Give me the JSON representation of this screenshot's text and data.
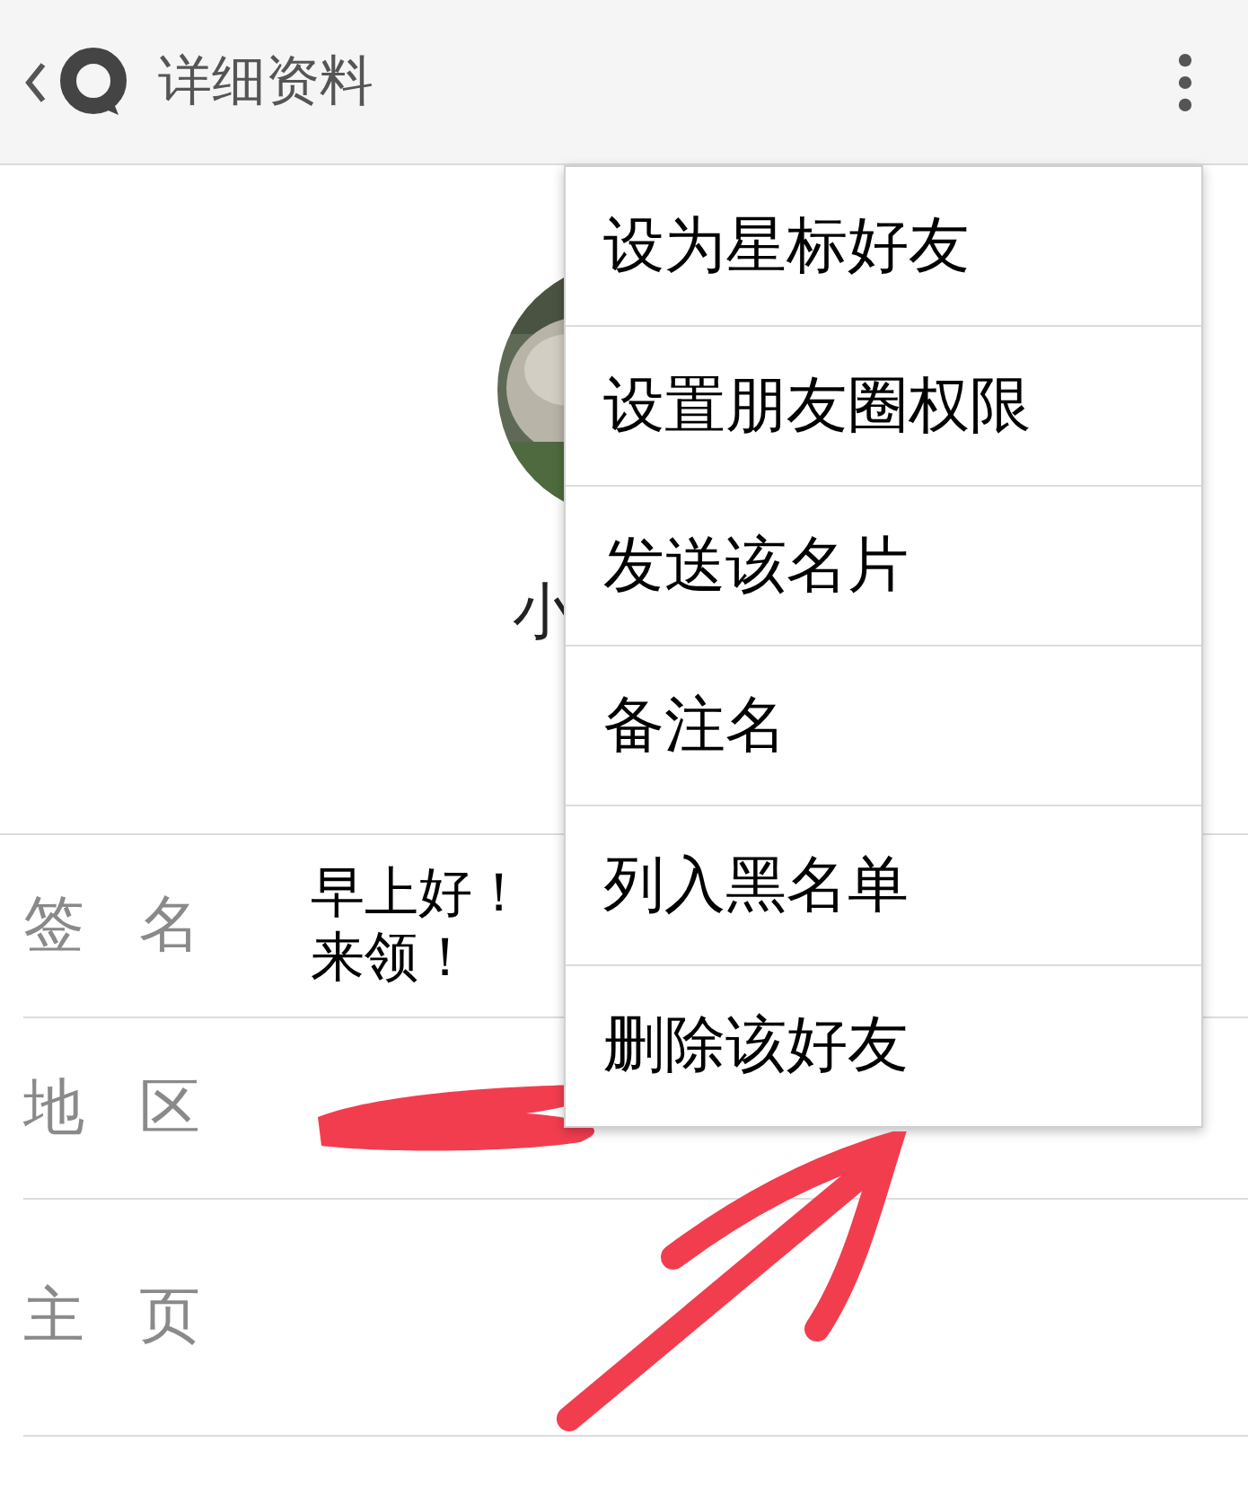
{
  "header": {
    "title": "详细资料"
  },
  "profile": {
    "name": "小"
  },
  "details": [
    {
      "label": "签名",
      "value": "早上好！来领！"
    },
    {
      "label": "地区",
      "redacted": true
    },
    {
      "label": "主页"
    }
  ],
  "menu": {
    "items": [
      "设为星标好友",
      "设置朋友圈权限",
      "发送该名片",
      "备注名",
      "列入黑名单",
      "删除该好友"
    ]
  }
}
